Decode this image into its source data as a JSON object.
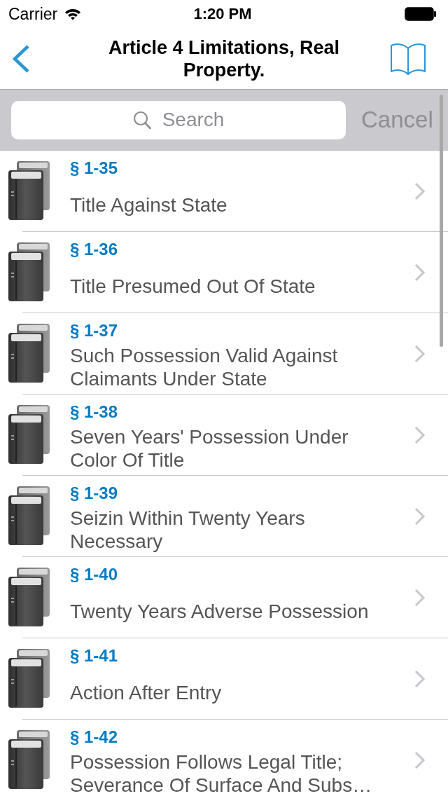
{
  "status_bar": {
    "carrier": "Carrier",
    "time": "1:20 PM"
  },
  "nav_bar": {
    "title": "Article 4 Limitations, Real Property."
  },
  "search_bar": {
    "placeholder": "Search",
    "cancel": "Cancel"
  },
  "sections": [
    {
      "number": "§ 1-35",
      "title": "Title Against State"
    },
    {
      "number": "§ 1-36",
      "title": "Title Presumed Out Of State"
    },
    {
      "number": "§ 1-37",
      "title": "Such Possession Valid Against Claimants Under State"
    },
    {
      "number": "§ 1-38",
      "title": "Seven Years' Possession Under Color Of Title"
    },
    {
      "number": "§ 1-39",
      "title": "Seizin Within Twenty Years Necessary"
    },
    {
      "number": "§ 1-40",
      "title": "Twenty Years Adverse Possession"
    },
    {
      "number": "§ 1-41",
      "title": "Action After Entry"
    },
    {
      "number": "§ 1-42",
      "title": "Possession Follows Legal Title; Severance Of Surface And Subs…"
    }
  ]
}
